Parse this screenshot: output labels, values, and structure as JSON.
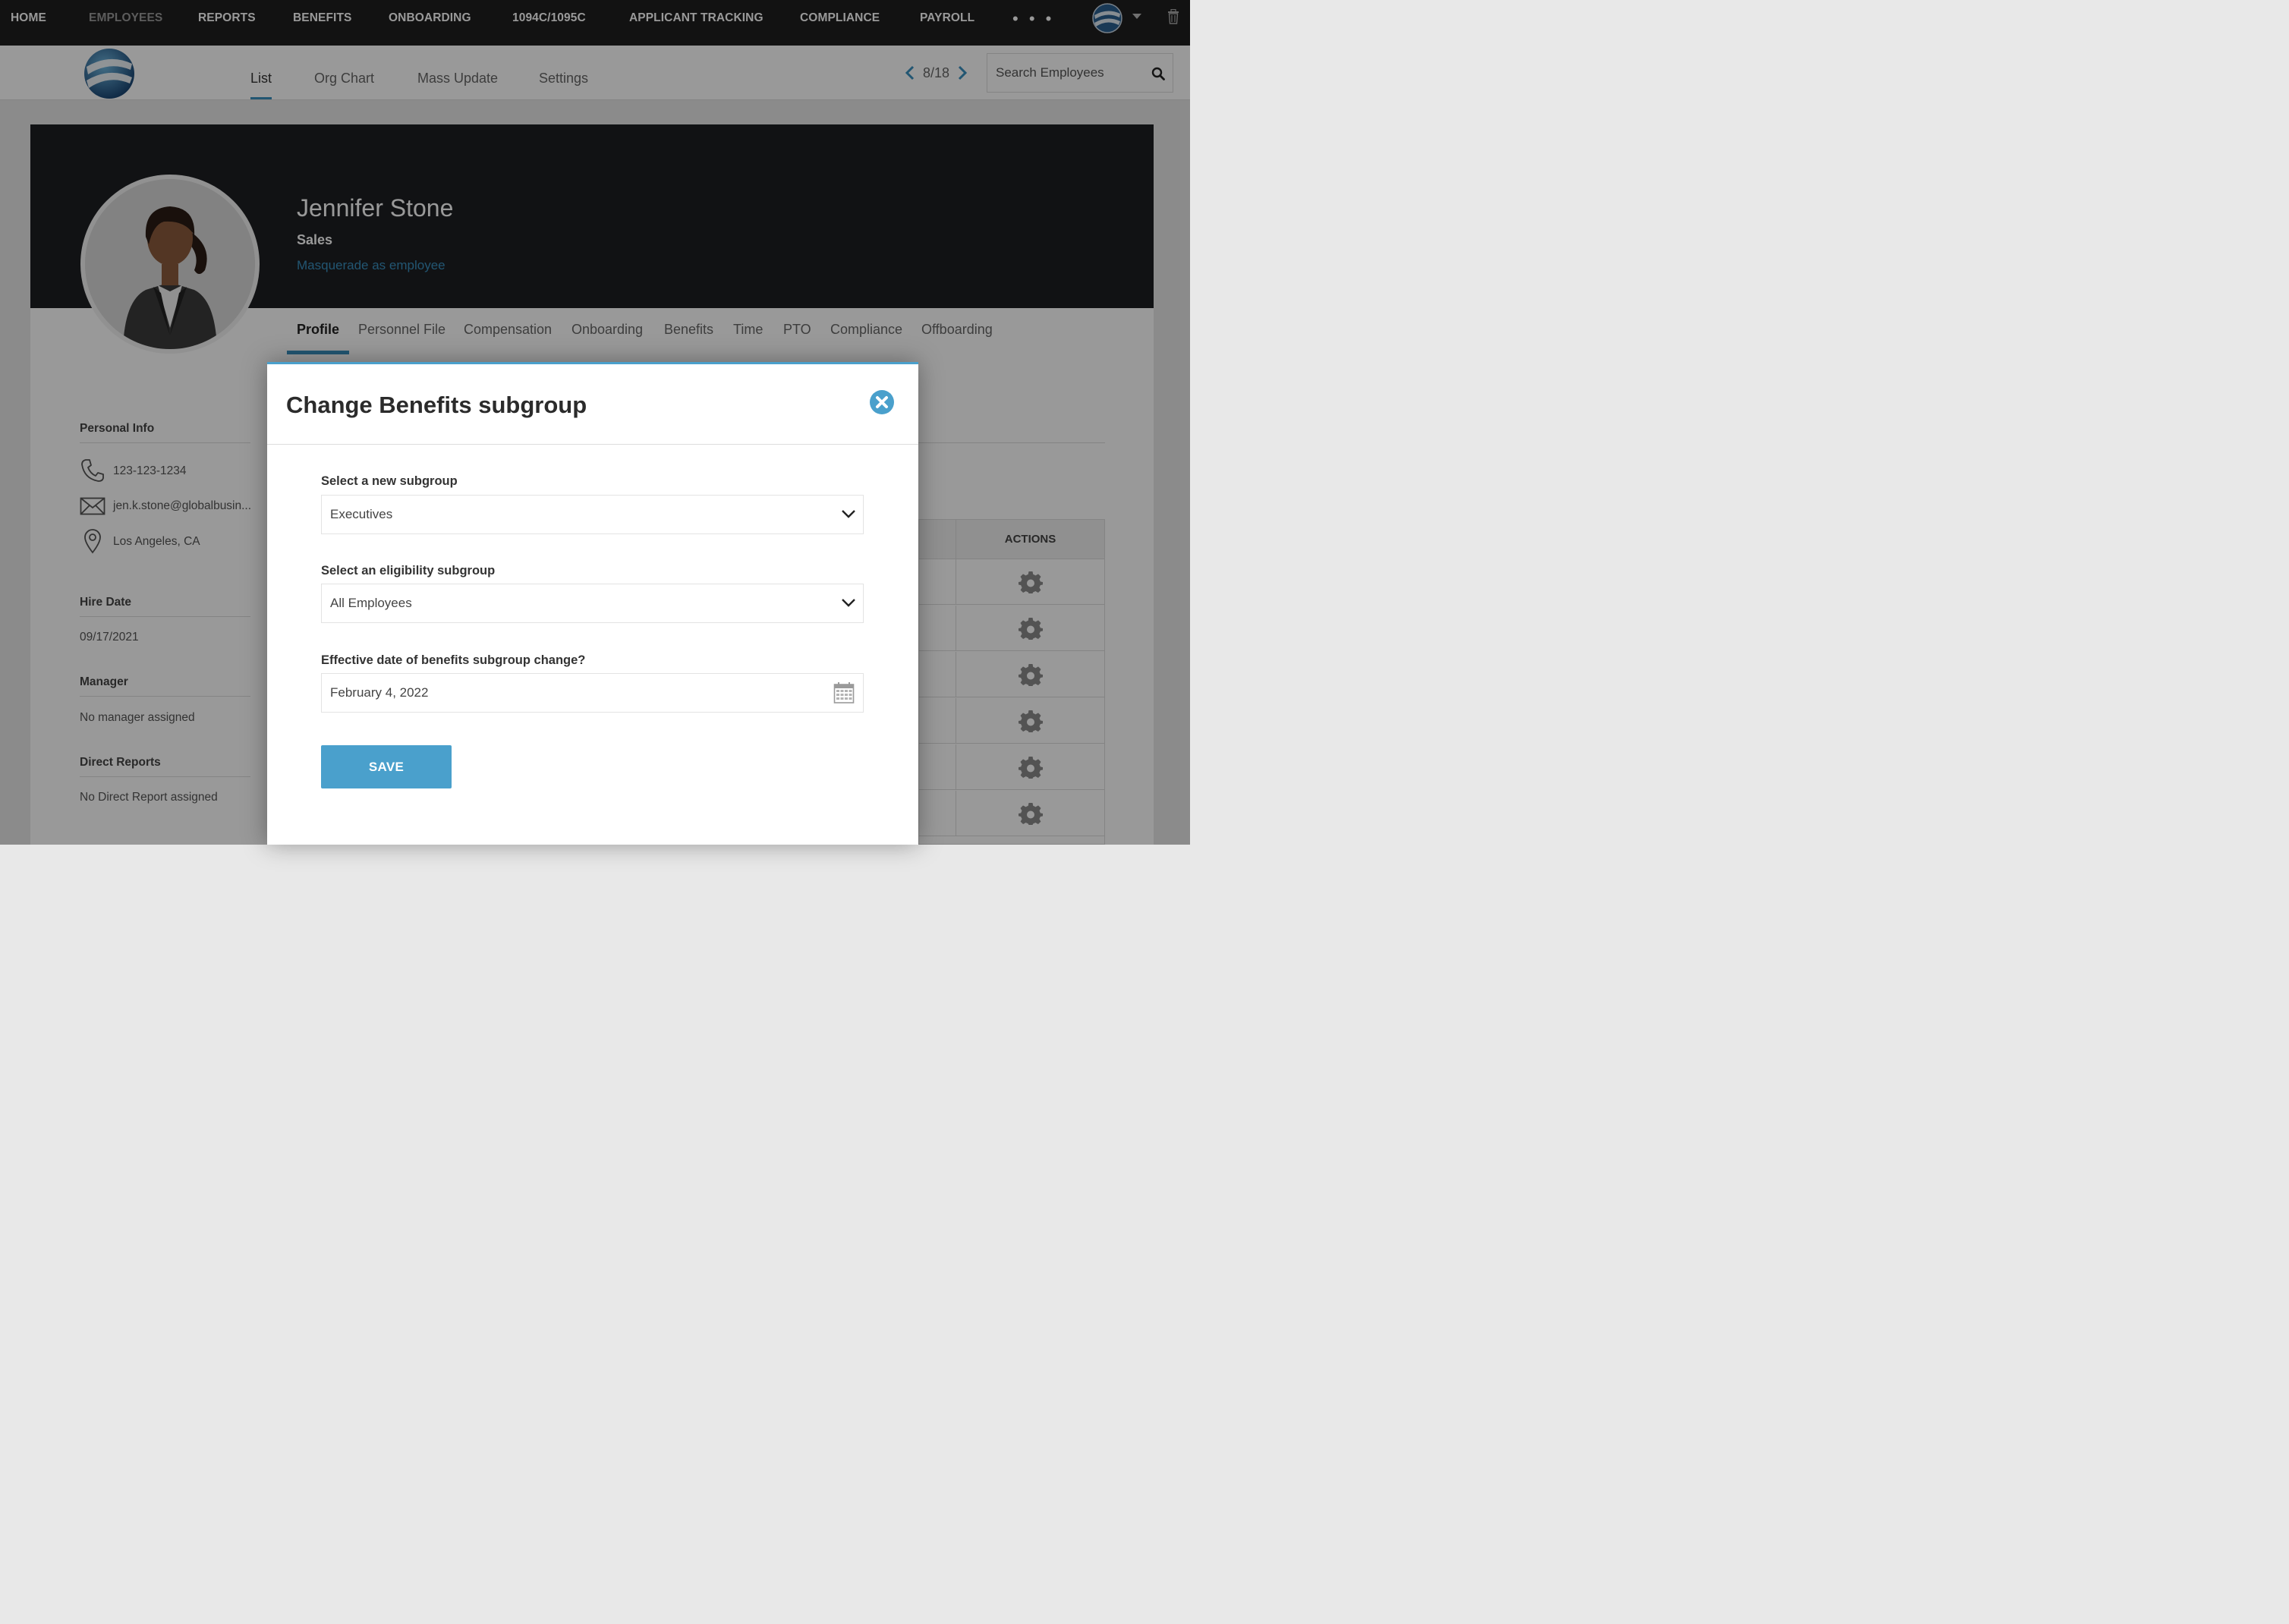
{
  "topnav": {
    "items": [
      {
        "label": "HOME",
        "active": false
      },
      {
        "label": "EMPLOYEES",
        "active": true
      },
      {
        "label": "REPORTS",
        "active": false
      },
      {
        "label": "BENEFITS",
        "active": false
      },
      {
        "label": "ONBOARDING",
        "active": false
      },
      {
        "label": "1094C/1095C",
        "active": false
      },
      {
        "label": "APPLICANT TRACKING",
        "active": false
      },
      {
        "label": "COMPLIANCE",
        "active": false
      },
      {
        "label": "PAYROLL",
        "active": false
      }
    ],
    "more": "• • •"
  },
  "subnav": {
    "tabs": [
      {
        "label": "List",
        "active": true
      },
      {
        "label": "Org Chart",
        "active": false
      },
      {
        "label": "Mass Update",
        "active": false
      },
      {
        "label": "Settings",
        "active": false
      }
    ],
    "pager": "8/18",
    "search_placeholder": "Search Employees"
  },
  "employee": {
    "name": "Jennifer Stone",
    "department": "Sales",
    "masquerade_link": "Masquerade as employee"
  },
  "profile_tabs": [
    {
      "label": "Profile",
      "active": true
    },
    {
      "label": "Personnel File",
      "active": false
    },
    {
      "label": "Compensation",
      "active": false
    },
    {
      "label": "Onboarding",
      "active": false
    },
    {
      "label": "Benefits",
      "active": false
    },
    {
      "label": "Time",
      "active": false
    },
    {
      "label": "PTO",
      "active": false
    },
    {
      "label": "Compliance",
      "active": false
    },
    {
      "label": "Offboarding",
      "active": false
    }
  ],
  "sidebar": {
    "personal_info_heading": "Personal Info",
    "phone": "123-123-1234",
    "email": "jen.k.stone@globalbusin...",
    "location": "Los Angeles, CA",
    "hire_date_heading": "Hire Date",
    "hire_date": "09/17/2021",
    "manager_heading": "Manager",
    "manager": "No manager assigned",
    "direct_reports_heading": "Direct Reports",
    "direct_reports": "No Direct Report assigned"
  },
  "table": {
    "actions_header": "ACTIONS"
  },
  "modal": {
    "title": "Change Benefits subgroup",
    "subgroup_label": "Select a new subgroup",
    "subgroup_value": "Executives",
    "eligibility_label": "Select an eligibility subgroup",
    "eligibility_value": "All Employees",
    "date_label": "Effective date of benefits subgroup change?",
    "date_value": "February 4, 2022",
    "save_label": "SAVE"
  },
  "colors": {
    "accent": "#4aa0cc",
    "topnav_bg": "#1f1f1f",
    "hero_bg": "#1d1e22"
  }
}
